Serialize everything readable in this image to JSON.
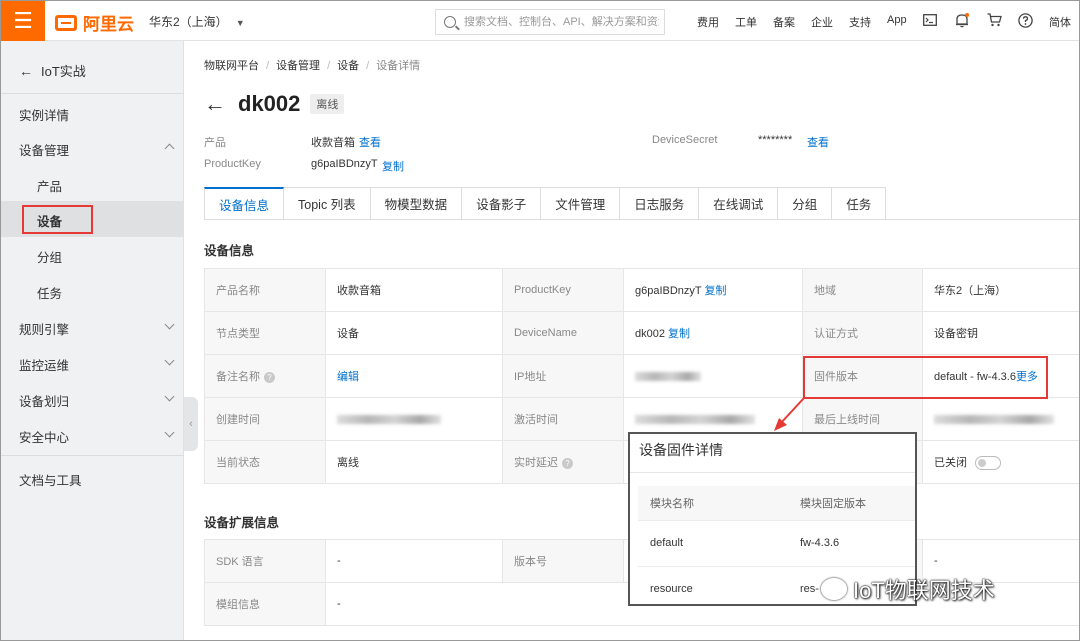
{
  "topbar": {
    "brand": "阿里云",
    "region": "华东2（上海）",
    "search_placeholder": "搜索文档、控制台、API、解决方案和资源",
    "links": [
      "费用",
      "工单",
      "备案",
      "企业",
      "支持",
      "App"
    ],
    "lang": "简体",
    "icons": [
      "menu-icon",
      "terminal-icon",
      "bell-icon",
      "cart-icon",
      "help-icon"
    ]
  },
  "sidebar": {
    "back_label": "IoT实战",
    "items": {
      "instance": "实例详情",
      "device_mgmt": "设备管理",
      "product": "产品",
      "device": "设备",
      "group": "分组",
      "task": "任务",
      "rules": "规则引擎",
      "monitor": "监控运维",
      "assign": "设备划归",
      "security": "安全中心",
      "docs": "文档与工具"
    }
  },
  "breadcrumb": [
    "物联网平台",
    "设备管理",
    "设备",
    "设备详情"
  ],
  "device": {
    "name": "dk002",
    "status": "离线",
    "product_label": "产品",
    "product_value": "收款音箱",
    "view": "查看",
    "productkey_label": "ProductKey",
    "productkey_value": "g6paIBDnzyT",
    "copy": "复制",
    "secret_label": "DeviceSecret",
    "secret_value": "********",
    "secret_view": "查看"
  },
  "tabs": [
    "设备信息",
    "Topic 列表",
    "物模型数据",
    "设备影子",
    "文件管理",
    "日志服务",
    "在线调试",
    "分组",
    "任务"
  ],
  "info": {
    "title": "设备信息",
    "r1": {
      "k1": "产品名称",
      "v1": "收款音箱",
      "k2": "ProductKey",
      "v2": "g6paIBDnzyT",
      "copy": "复制",
      "k3": "地域",
      "v3": "华东2（上海）"
    },
    "r2": {
      "k1": "节点类型",
      "v1": "设备",
      "k2": "DeviceName",
      "v2": "dk002",
      "copy": "复制",
      "k3": "认证方式",
      "v3": "设备密钥"
    },
    "r3": {
      "k1": "备注名称",
      "v1": "编辑",
      "k2": "IP地址",
      "k3": "固件版本",
      "v3": "default - fw-4.3.6",
      "more": "更多"
    },
    "r4": {
      "k1": "创建时间",
      "k2": "激活时间",
      "k3": "最后上线时间"
    },
    "r5": {
      "k1": "当前状态",
      "v1": "离线",
      "k2": "实时延迟",
      "v3": "已关闭"
    }
  },
  "ext": {
    "title": "设备扩展信息",
    "r1": {
      "k1": "SDK 语言",
      "v1": "-",
      "k2": "版本号",
      "v3": "-"
    },
    "r2": {
      "k1": "模组信息",
      "v1": "-"
    }
  },
  "popup": {
    "title": "设备固件详情",
    "col1": "模块名称",
    "col2": "模块固定版本",
    "rows": [
      {
        "name": "default",
        "version": "fw-4.3.6"
      },
      {
        "name": "resource",
        "version": "res-"
      }
    ]
  },
  "watermark": "IoT物联网技术",
  "colors": {
    "brand": "#ff6a00",
    "link": "#0070cc",
    "highlight": "#e53935"
  }
}
